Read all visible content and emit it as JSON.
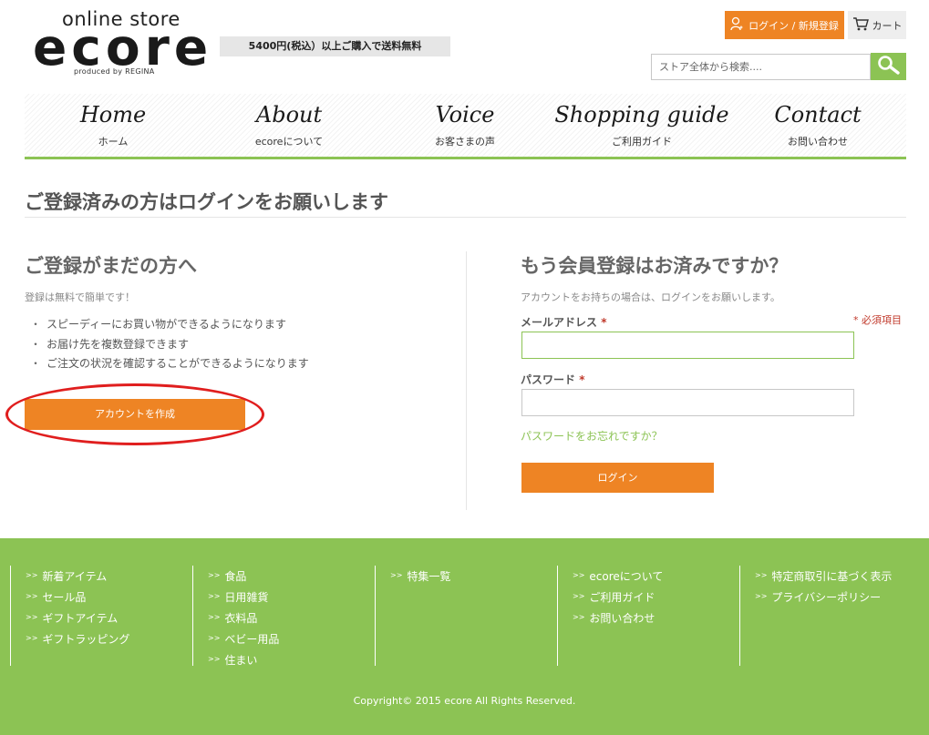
{
  "header": {
    "logo_top": "online store",
    "logo_main": "ecore",
    "logo_sub": "produced by REGINA",
    "promo": "5400円(税込）以上ご購入で送料無料",
    "login_register": "ログイン / 新規登録",
    "cart": "カート",
    "search_placeholder": "ストア全体から検索....",
    "icons": {
      "login": "user-icon",
      "cart": "cart-icon",
      "search": "magnifier-icon"
    }
  },
  "nav": {
    "items": [
      {
        "en": "Home",
        "ja": "ホーム"
      },
      {
        "en": "About",
        "ja": "ecoreについて"
      },
      {
        "en": "Voice",
        "ja": "お客さまの声"
      },
      {
        "en": "Shopping guide",
        "ja": "ご利用ガイド"
      },
      {
        "en": "Contact",
        "ja": "お問い合わせ"
      }
    ]
  },
  "main": {
    "page_title": "ご登録済みの方はログインをお願いします",
    "new_customer": {
      "heading": "ご登録がまだの方へ",
      "note": "登録は無料で簡単です！",
      "benefits": [
        "スピーディーにお買い物ができるようになります",
        "お届け先を複数登録できます",
        "ご注文の状況を確認することができるようになります"
      ],
      "bullet": "・",
      "create_account": "アカウントを作成"
    },
    "registered": {
      "heading": "もう会員登録はお済みですか？",
      "note": "アカウントをお持ちの場合は、ログインをお願いします。",
      "required_note": "* 必須項目",
      "email_label": "メールアドレス",
      "password_label": "パスワード",
      "required_mark": "*",
      "email_value": "",
      "password_value": "",
      "forgot_password": "パスワードをお忘れですか？",
      "login_button": "ログイン"
    }
  },
  "footer": {
    "chevron": ">>",
    "columns": [
      [
        "新着アイテム",
        "セール品",
        "ギフトアイテム",
        "ギフトラッピング"
      ],
      [
        "食品",
        "日用雑貨",
        "衣料品",
        "ベビー用品",
        "住まい"
      ],
      [
        "特集一覧"
      ],
      [
        "ecoreについて",
        "ご利用ガイド",
        "お問い合わせ"
      ],
      [
        "特定商取引に基づく表示",
        "プライバシーポリシー"
      ]
    ],
    "copyright": "Copyright© 2015 ecore All Rights Reserved."
  },
  "colors": {
    "accent_orange": "#ee8424",
    "accent_green": "#8cc354",
    "annotation_red": "#e01e1e",
    "required_red": "#c0392b"
  }
}
